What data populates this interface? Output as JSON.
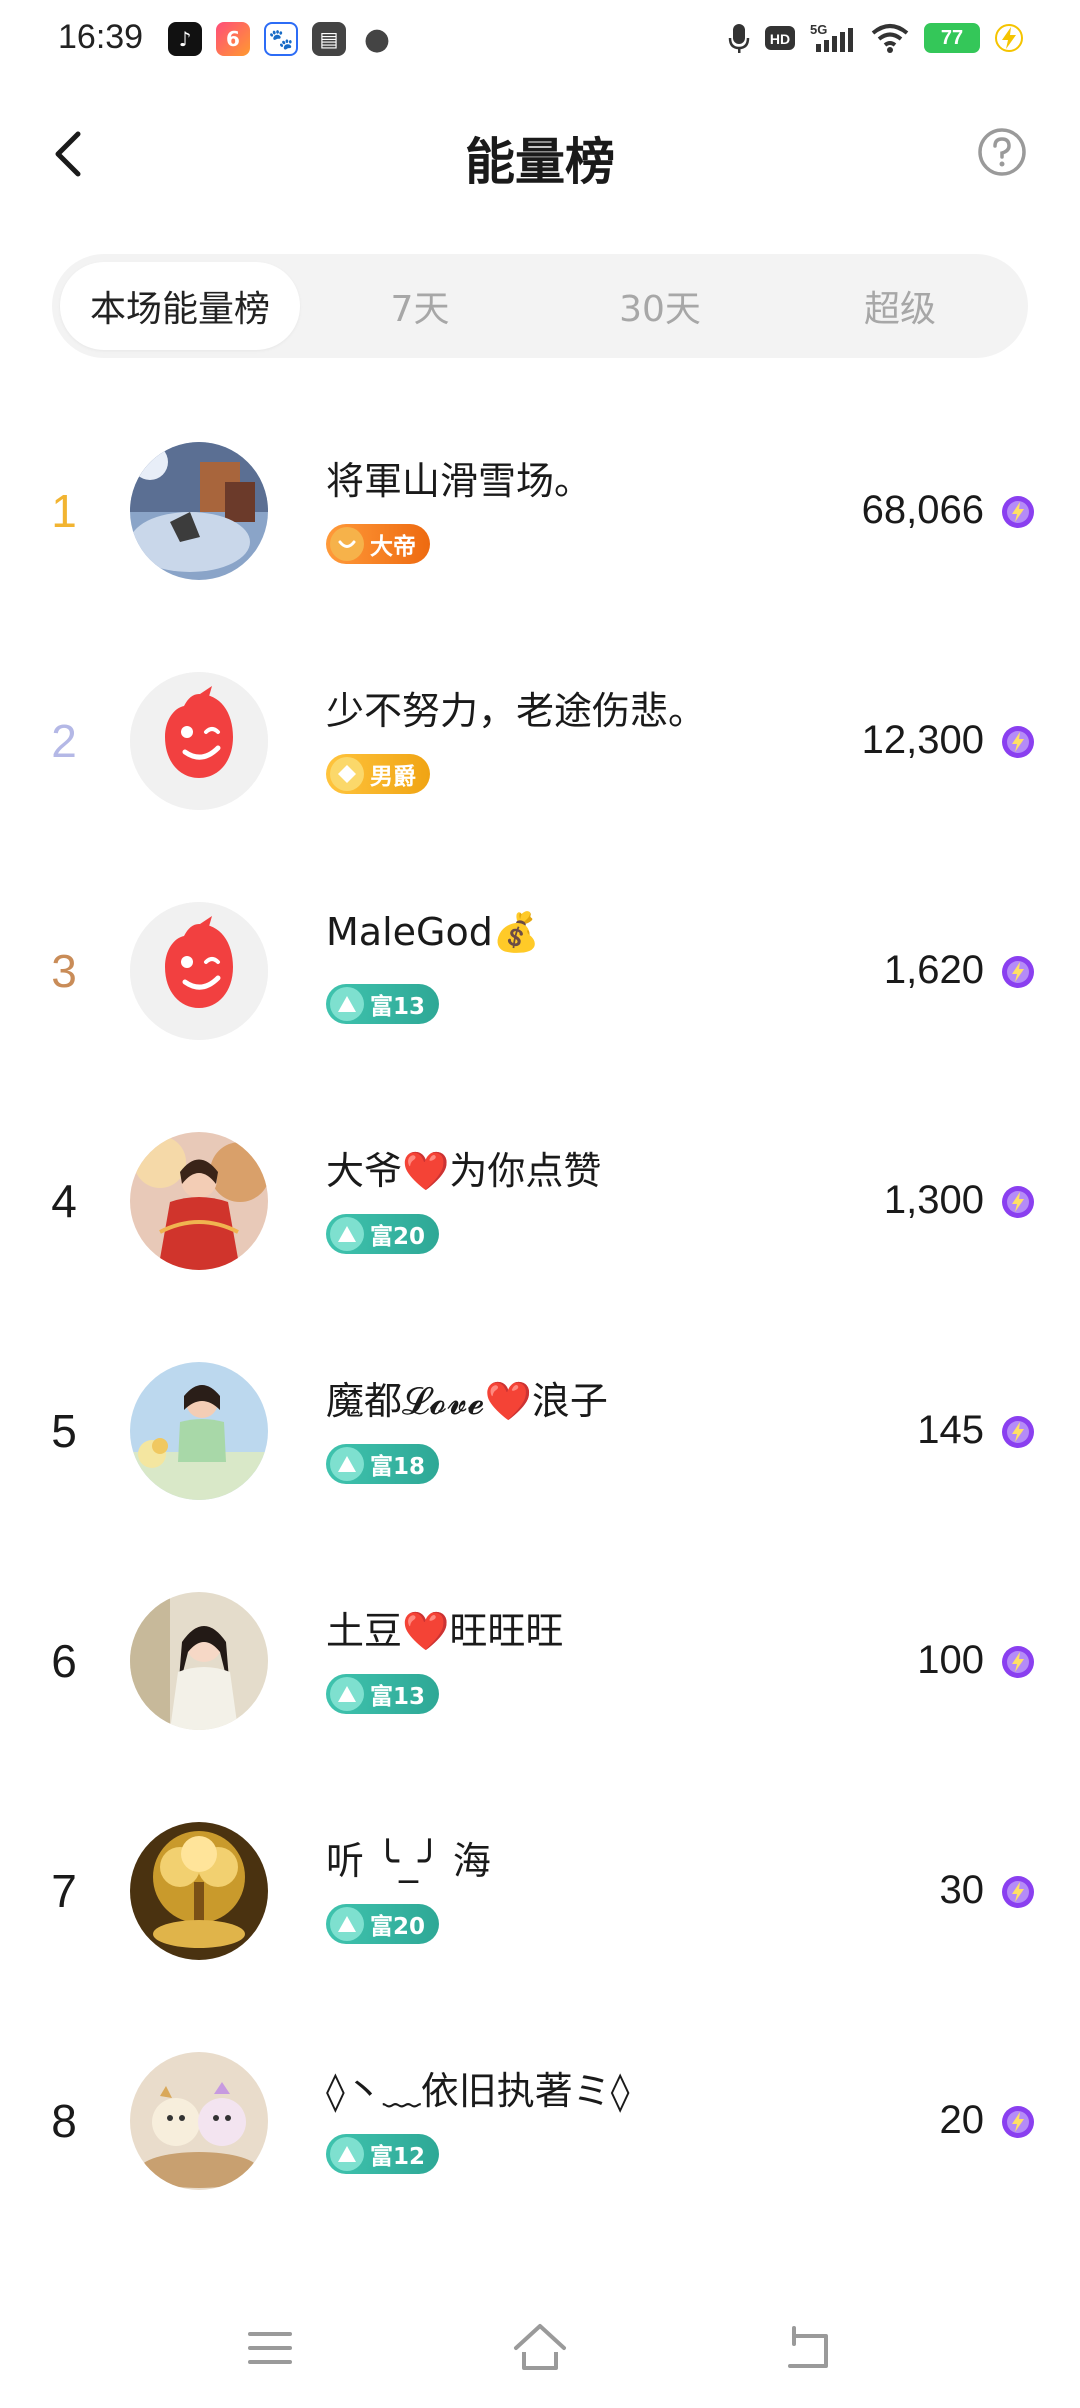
{
  "status_bar": {
    "time": "16:39",
    "battery": "77",
    "app_icons": [
      "tiktok-icon",
      "video-app-icon",
      "baidu-icon",
      "card-app-icon",
      "chat-bubble-icon"
    ],
    "indicators": [
      "mic-icon",
      "hd-icon",
      "5g-signal-icon",
      "wifi-icon",
      "battery-icon",
      "charging-icon"
    ]
  },
  "header": {
    "title": "能量榜",
    "back_icon": "chevron-left-icon",
    "help_icon": "question-circle-icon"
  },
  "tabs": [
    {
      "label": "本场能量榜",
      "active": true
    },
    {
      "label": "7天",
      "active": false
    },
    {
      "label": "30天",
      "active": false
    },
    {
      "label": "超级",
      "active": false
    }
  ],
  "ranking": [
    {
      "rank": "1",
      "name": "将軍山滑雪场。",
      "badge": "大帝",
      "score": "68,066"
    },
    {
      "rank": "2",
      "name": "少不努力，老途伤悲。",
      "badge": "男爵",
      "score": "12,300"
    },
    {
      "rank": "3",
      "name": "MaleGod💰",
      "badge": "富13",
      "score": "1,620"
    },
    {
      "rank": "4",
      "name": "大爷❤️为你点赞",
      "badge": "富20",
      "score": "1,300"
    },
    {
      "rank": "5",
      "name": "魔都𝓛𝓸𝓿𝓮❤️浪子",
      "badge": "富18",
      "score": "145"
    },
    {
      "rank": "6",
      "name": "土豆❤️旺旺旺",
      "badge": "富13",
      "score": "100"
    },
    {
      "rank": "7",
      "name": "听 ╰_╯ 海",
      "badge": "富20",
      "score": "30"
    },
    {
      "rank": "8",
      "name": "◊丶﹏依旧执著ミ◊",
      "badge": "富12",
      "score": "20"
    }
  ],
  "colors": {
    "rank1": "#f2b431",
    "rank2": "#b4b8e6",
    "rank3": "#c98c58",
    "rank_other": "#1a1a1a",
    "tab_bg": "#f3f3f3",
    "wealth_badge": "#36b3a1",
    "emperor_badge": "#f27a1a",
    "baron_badge": "#f5b21e",
    "energy": "#8a3ff0"
  },
  "nav_bar": {
    "icons": [
      "menu-icon",
      "home-icon",
      "back-icon"
    ]
  }
}
